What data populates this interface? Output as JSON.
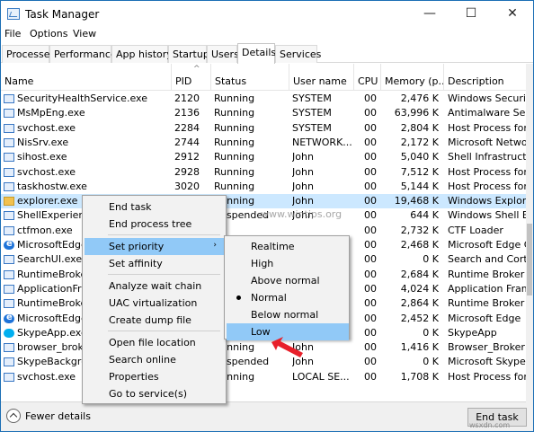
{
  "window": {
    "title": "Task Manager",
    "controls": {
      "minimize": "—",
      "maximize": "☐",
      "close": "✕"
    }
  },
  "menu": [
    "File",
    "Options",
    "View"
  ],
  "tabs": [
    "Processes",
    "Performance",
    "App history",
    "Startup",
    "Users",
    "Details",
    "Services"
  ],
  "active_tab": "Details",
  "columns": {
    "name": "Name",
    "pid": "PID",
    "status": "Status",
    "user": "User name",
    "cpu": "CPU",
    "memory": "Memory (p...",
    "description": "Description"
  },
  "rows": [
    {
      "name": "SecurityHealthService.exe",
      "pid": "2120",
      "status": "Running",
      "user": "SYSTEM",
      "cpu": "00",
      "memory": "2,476 K",
      "description": "Windows Security H",
      "icon": "app"
    },
    {
      "name": "MsMpEng.exe",
      "pid": "2136",
      "status": "Running",
      "user": "SYSTEM",
      "cpu": "00",
      "memory": "63,996 K",
      "description": "Antimalware Servic",
      "icon": "app"
    },
    {
      "name": "svchost.exe",
      "pid": "2284",
      "status": "Running",
      "user": "SYSTEM",
      "cpu": "00",
      "memory": "2,804 K",
      "description": "Host Process for W",
      "icon": "app"
    },
    {
      "name": "NisSrv.exe",
      "pid": "2744",
      "status": "Running",
      "user": "NETWORK...",
      "cpu": "00",
      "memory": "2,172 K",
      "description": "Microsoft Network",
      "icon": "app"
    },
    {
      "name": "sihost.exe",
      "pid": "2912",
      "status": "Running",
      "user": "John",
      "cpu": "00",
      "memory": "5,040 K",
      "description": "Shell Infrastructure",
      "icon": "app"
    },
    {
      "name": "svchost.exe",
      "pid": "2928",
      "status": "Running",
      "user": "John",
      "cpu": "00",
      "memory": "7,512 K",
      "description": "Host Process for W",
      "icon": "app"
    },
    {
      "name": "taskhostw.exe",
      "pid": "3020",
      "status": "Running",
      "user": "John",
      "cpu": "00",
      "memory": "5,144 K",
      "description": "Host Process for W",
      "icon": "app"
    },
    {
      "name": "explorer.exe",
      "pid": "",
      "status": "Running",
      "user": "John",
      "cpu": "00",
      "memory": "19,468 K",
      "description": "Windows Explorer",
      "icon": "folder"
    },
    {
      "name": "ShellExperienceH",
      "pid": "",
      "status": "Suspended",
      "user": "John",
      "cpu": "00",
      "memory": "644 K",
      "description": "Windows Shell Exp",
      "icon": "app"
    },
    {
      "name": "ctfmon.exe",
      "pid": "",
      "status": "",
      "user": "",
      "cpu": "00",
      "memory": "2,732 K",
      "description": "CTF Loader",
      "icon": "app"
    },
    {
      "name": "MicrosoftEdgeCP",
      "pid": "",
      "status": "",
      "user": "",
      "cpu": "00",
      "memory": "2,468 K",
      "description": "Microsoft Edge Co",
      "icon": "edge"
    },
    {
      "name": "SearchUI.exe",
      "pid": "",
      "status": "",
      "user": "",
      "cpu": "00",
      "memory": "0 K",
      "description": "Search and Cortan",
      "icon": "app"
    },
    {
      "name": "RuntimeBroker.exe",
      "pid": "",
      "status": "",
      "user": "",
      "cpu": "00",
      "memory": "2,684 K",
      "description": "Runtime Broker",
      "icon": "app"
    },
    {
      "name": "ApplicationFram",
      "pid": "",
      "status": "",
      "user": "",
      "cpu": "00",
      "memory": "4,024 K",
      "description": "Application Frame",
      "icon": "app"
    },
    {
      "name": "RuntimeBroker.exe",
      "pid": "",
      "status": "",
      "user": "",
      "cpu": "00",
      "memory": "2,864 K",
      "description": "Runtime Broker",
      "icon": "app"
    },
    {
      "name": "MicrosoftEdge.exe",
      "pid": "",
      "status": "",
      "user": "",
      "cpu": "00",
      "memory": "2,452 K",
      "description": "Microsoft Edge",
      "icon": "edge"
    },
    {
      "name": "SkypeApp.exe",
      "pid": "",
      "status": "",
      "user": "",
      "cpu": "00",
      "memory": "0 K",
      "description": "SkypeApp",
      "icon": "skype"
    },
    {
      "name": "browser_broker.",
      "pid": "",
      "status": "Running",
      "user": "John",
      "cpu": "00",
      "memory": "1,416 K",
      "description": "Browser_Broker",
      "icon": "app"
    },
    {
      "name": "SkypeBackgroun",
      "pid": "",
      "status": "Suspended",
      "user": "John",
      "cpu": "00",
      "memory": "0 K",
      "description": "Microsoft Skype",
      "icon": "app"
    },
    {
      "name": "svchost.exe",
      "pid": "",
      "status": "Running",
      "user": "LOCAL SE...",
      "cpu": "00",
      "memory": "1,708 K",
      "description": "Host Process for W",
      "icon": "app"
    }
  ],
  "context_menu": {
    "items": [
      "End task",
      "End process tree",
      "Set priority",
      "Set affinity",
      "Analyze wait chain",
      "UAC virtualization",
      "Create dump file",
      "Open file location",
      "Search online",
      "Properties",
      "Go to service(s)"
    ],
    "submenu_arrow": "›"
  },
  "priority_submenu": {
    "items": [
      "Realtime",
      "High",
      "Above normal",
      "Normal",
      "Below normal",
      "Low"
    ],
    "selected": "Normal",
    "hovered": "Low"
  },
  "footer": {
    "fewer_details": "Fewer details",
    "end_task": "End task"
  },
  "watermarks": {
    "center": "www.wintips.org",
    "bottom": "wsxdn.com"
  },
  "colors": {
    "selection": "#cce8ff",
    "menu_hover": "#91c9f7",
    "pointer": "#e8202a",
    "title_border": "#1c6fb5"
  }
}
